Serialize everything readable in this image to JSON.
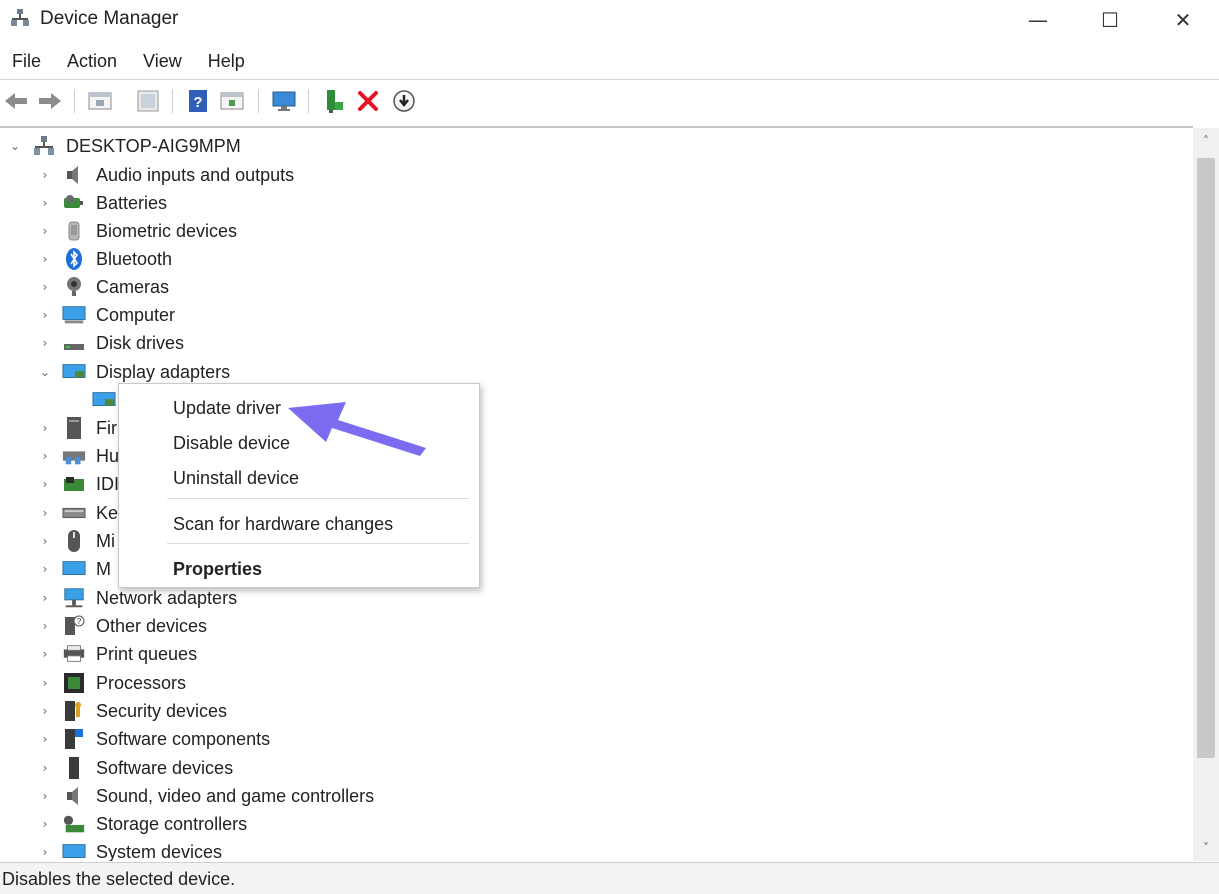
{
  "window": {
    "title": "Device Manager",
    "minimize_symbol": "—",
    "maximize_symbol": "☐",
    "close_symbol": "✕"
  },
  "menu": [
    "File",
    "Action",
    "View",
    "Help"
  ],
  "toolbar": {
    "icons": [
      "back-arrow-icon",
      "forward-arrow-icon",
      "show-hide-tree-icon",
      "properties-icon",
      "help-icon",
      "action-pane-icon",
      "monitor-icon",
      "update-driver-icon",
      "uninstall-icon",
      "scan-hardware-icon"
    ],
    "uninstall_color": "#e81123"
  },
  "tree": {
    "root": "DESKTOP-AIG9MPM",
    "items": [
      {
        "label": "Audio inputs and outputs",
        "icon": "speaker-icon",
        "expanded": false
      },
      {
        "label": "Batteries",
        "icon": "battery-icon",
        "expanded": false
      },
      {
        "label": "Biometric devices",
        "icon": "fingerprint-icon",
        "expanded": false
      },
      {
        "label": "Bluetooth",
        "icon": "bluetooth-icon",
        "expanded": false
      },
      {
        "label": "Cameras",
        "icon": "camera-icon",
        "expanded": false
      },
      {
        "label": "Computer",
        "icon": "computer-icon",
        "expanded": false
      },
      {
        "label": "Disk drives",
        "icon": "disk-drive-icon",
        "expanded": false
      },
      {
        "label": "Display adapters",
        "icon": "display-adapter-icon",
        "expanded": true
      },
      {
        "label": "",
        "icon": "display-adapter-icon",
        "child": true
      },
      {
        "label": "Fir",
        "icon": "firmware-icon",
        "expanded": false
      },
      {
        "label": "Hu",
        "icon": "hid-icon",
        "expanded": false
      },
      {
        "label": "IDI",
        "icon": "ide-controller-icon",
        "expanded": false
      },
      {
        "label": "Ke",
        "icon": "keyboard-icon",
        "expanded": false
      },
      {
        "label": "Mi",
        "icon": "mouse-icon",
        "expanded": false
      },
      {
        "label": "M",
        "icon": "monitor-icon",
        "expanded": false
      },
      {
        "label": "Network adapters",
        "icon": "network-adapter-icon",
        "expanded": false
      },
      {
        "label": "Other devices",
        "icon": "other-device-icon",
        "expanded": false
      },
      {
        "label": "Print queues",
        "icon": "printer-icon",
        "expanded": false
      },
      {
        "label": "Processors",
        "icon": "processor-icon",
        "expanded": false
      },
      {
        "label": "Security devices",
        "icon": "security-device-icon",
        "expanded": false
      },
      {
        "label": "Software components",
        "icon": "software-component-icon",
        "expanded": false
      },
      {
        "label": "Software devices",
        "icon": "software-device-icon",
        "expanded": false
      },
      {
        "label": "Sound, video and game controllers",
        "icon": "speaker-icon",
        "expanded": false
      },
      {
        "label": "Storage controllers",
        "icon": "storage-controller-icon",
        "expanded": false
      },
      {
        "label": "System devices",
        "icon": "system-device-icon",
        "expanded": false
      }
    ]
  },
  "context_menu": {
    "update_driver": "Update driver",
    "disable_device": "Disable device",
    "uninstall_device": "Uninstall device",
    "scan_hardware": "Scan for hardware changes",
    "properties": "Properties"
  },
  "annotation": {
    "arrow_color": "#7b6cf0"
  },
  "status": "Disables the selected device."
}
